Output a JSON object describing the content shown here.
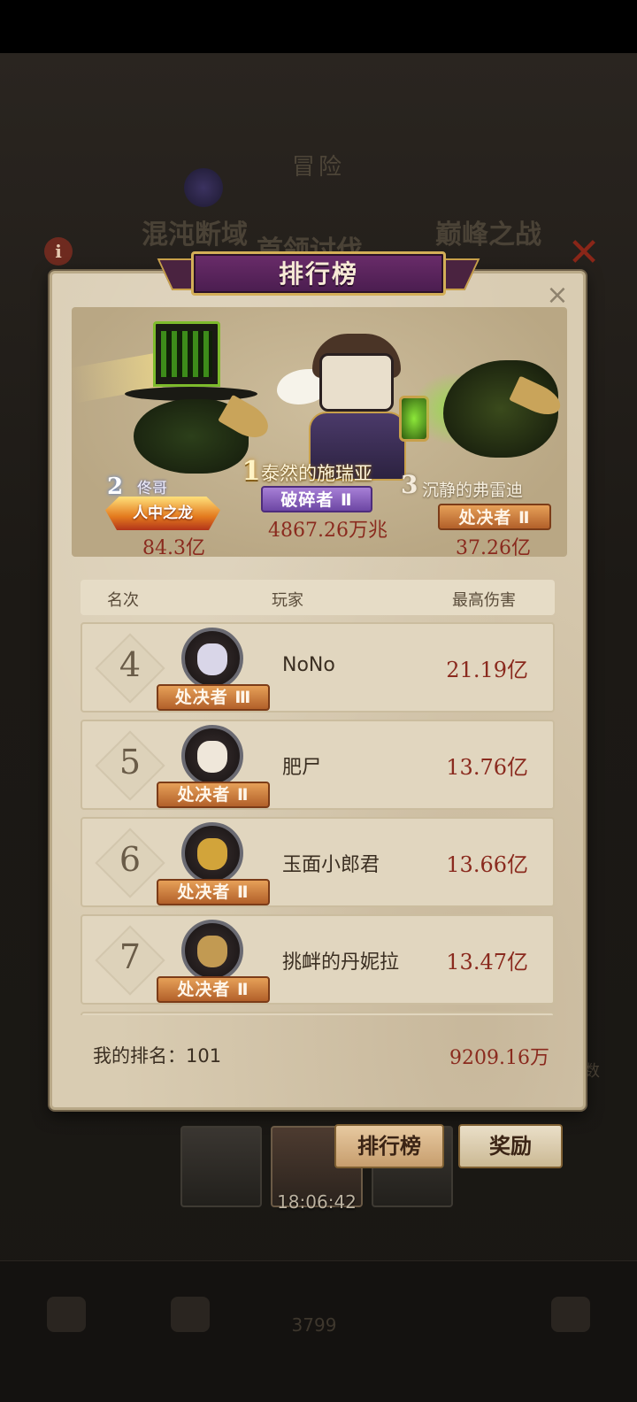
{
  "background": {
    "screen_title": "冒险",
    "tabs": [
      "混沌断域",
      "首领讨伐",
      "巅峰之战"
    ],
    "timer": "18:06:42",
    "side_text": "数",
    "bottom_count": "3799"
  },
  "panel": {
    "title": "排行榜",
    "close_icon": "close-icon",
    "info_icon": "info-icon"
  },
  "podium": {
    "first": {
      "rank": "1",
      "name": "泰然的施瑞亚",
      "title": "破碎者 Ⅱ",
      "score": "4867.26万兆"
    },
    "second": {
      "rank": "2",
      "name": "佟哥",
      "title": "人中之龙",
      "score": "84.3亿"
    },
    "third": {
      "rank": "3",
      "name": "沉静的弗雷迪",
      "title": "处决者 Ⅱ",
      "score": "37.26亿"
    }
  },
  "table": {
    "headers": {
      "rank": "名次",
      "player": "玩家",
      "damage": "最高伤害"
    },
    "rows": [
      {
        "rank": "4",
        "name": "NoNo",
        "title": "处决者 Ⅲ",
        "damage": "21.19亿",
        "face_color": "#d9d6e8"
      },
      {
        "rank": "5",
        "name": "肥尸",
        "title": "处决者 Ⅱ",
        "damage": "13.76亿",
        "face_color": "#efe7da"
      },
      {
        "rank": "6",
        "name": "玉面小郎君",
        "title": "处决者 Ⅱ",
        "damage": "13.66亿",
        "face_color": "#d2a43a"
      },
      {
        "rank": "7",
        "name": "挑衅的丹妮拉",
        "title": "处决者 Ⅱ",
        "damage": "13.47亿",
        "face_color": "#c29a52"
      }
    ]
  },
  "my_rank": {
    "label": "我的排名：101",
    "value": "9209.16万"
  },
  "buttons": {
    "rank": "排行榜",
    "reward": "奖励"
  },
  "colors": {
    "accent_purple": "#6a2c6a",
    "damage_red": "#8a2a1e",
    "parchment": "#d9ccb2",
    "title_orange": "#b2602a"
  }
}
